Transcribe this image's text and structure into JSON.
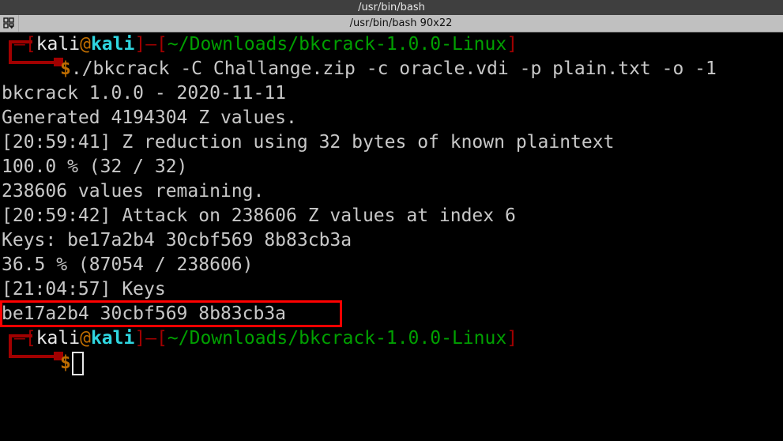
{
  "window": {
    "title": "/usr/bin/bash"
  },
  "tabbar": {
    "menu_icon": "grid-layout-dropdown-icon",
    "tab_label": "/usr/bin/bash 90x22"
  },
  "terminal": {
    "columns": 90,
    "rows": 22,
    "background": "#000000",
    "foreground": "#c8c8c8",
    "prompt1": {
      "bracket_open": "—[",
      "user": "kali",
      "at": "@",
      "host": "kali",
      "bracket_close": "]",
      "dash": "—",
      "path_open": "[",
      "path": "~/Downloads/bkcrack-1.0.0-Linux",
      "path_close": "]",
      "dollar": "$",
      "command": "./bkcrack -C Challange.zip -c oracle.vdi -p plain.txt -o -1"
    },
    "output_lines": [
      "bkcrack 1.0.0 - 2020-11-11",
      "Generated 4194304 Z values.",
      "[20:59:41] Z reduction using 32 bytes of known plaintext",
      "100.0 % (32 / 32)",
      "238606 values remaining.",
      "[20:59:42] Attack on 238606 Z values at index 6",
      "Keys: be17a2b4 30cbf569 8b83cb3a",
      "36.5 % (87054 / 238606)",
      "[21:04:57] Keys",
      "be17a2b4 30cbf569 8b83cb3a"
    ],
    "highlighted_line": "be17a2b4 30cbf569 8b83cb3a",
    "prompt2": {
      "bracket_open": "—[",
      "user": "kali",
      "at": "@",
      "host": "kali",
      "bracket_close": "]",
      "dash": "—",
      "path_open": "[",
      "path": "~/Downloads/bkcrack-1.0.0-Linux",
      "path_close": "]",
      "dollar": "$",
      "command": ""
    }
  },
  "annotation": {
    "color": "#ff0000",
    "shape": "rectangle",
    "target_text": "be17a2b4 30cbf569 8b83cb3a"
  },
  "colors": {
    "titlebar_bg": "#3f3f3f",
    "tabbar_bg": "#c0c0c0",
    "prompt_bracket": "#a10000",
    "prompt_user": "#e8e8e8",
    "prompt_at": "#bf6d00",
    "prompt_host": "#2fd6e0",
    "prompt_path": "#00a000",
    "prompt_dollar": "#bf6d00",
    "output_text": "#c8c8c8",
    "annotation": "#ff0000"
  }
}
